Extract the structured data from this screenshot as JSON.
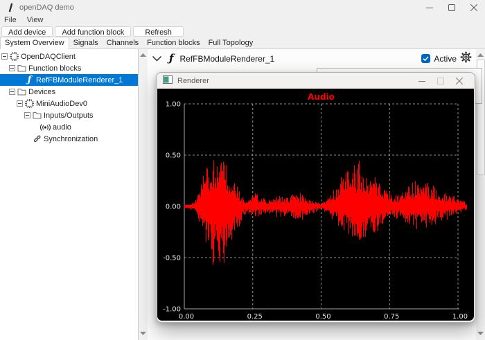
{
  "window": {
    "title": "openDAQ demo"
  },
  "menu": {
    "items": [
      "File",
      "View"
    ]
  },
  "toolbar": {
    "buttons": [
      "Add device",
      "Add function block",
      "Refresh"
    ]
  },
  "tabs": {
    "items": [
      "System Overview",
      "Signals",
      "Channels",
      "Function blocks",
      "Full Topology"
    ],
    "active": "System Overview"
  },
  "tree": {
    "items": [
      {
        "label": "OpenDAQClient",
        "icon": "chip",
        "level": 0,
        "expander": true,
        "selected": false
      },
      {
        "label": "Function blocks",
        "icon": "folder",
        "level": 1,
        "expander": true,
        "selected": false
      },
      {
        "label": "RefFBModuleRenderer_1",
        "icon": "fn",
        "level": 2,
        "expander": false,
        "selected": true
      },
      {
        "label": "Devices",
        "icon": "folder",
        "level": 1,
        "expander": true,
        "selected": false
      },
      {
        "label": "MiniAudioDev0",
        "icon": "chip",
        "level": 2,
        "expander": true,
        "selected": false
      },
      {
        "label": "Inputs/Outputs",
        "icon": "folder",
        "level": 3,
        "expander": true,
        "selected": false
      },
      {
        "label": "audio",
        "icon": "audio",
        "level": 4,
        "expander": false,
        "selected": false
      },
      {
        "label": "Synchronization",
        "icon": "link",
        "level": 3,
        "expander": false,
        "selected": false
      }
    ]
  },
  "detail": {
    "title": "RefFBModuleRenderer_1",
    "active_label": "Active",
    "active_checked": true
  },
  "renderer_window": {
    "title": "Renderer"
  },
  "colors": {
    "selection": "#0078d7",
    "checkbox_accent": "#0067c0"
  },
  "chart_data": {
    "type": "line",
    "title": "Audio",
    "title_color": "#ff0000",
    "series_color": "#ff0000",
    "background": "#000000",
    "grid": "dashed",
    "xlim": [
      0,
      1
    ],
    "ylim": [
      -1,
      1
    ],
    "x_ticks": [
      0.0,
      0.25,
      0.5,
      0.75,
      1.0
    ],
    "x_tick_labels": [
      "0.00",
      "0.25",
      "0.50",
      "0.75",
      "1.00"
    ],
    "y_ticks": [
      1.0,
      0.5,
      0.0,
      -0.5,
      -1.0
    ],
    "y_tick_labels": [
      "1.00",
      "0.50",
      "0.00",
      "-0.50",
      "-1.00"
    ],
    "envelope": [
      [
        0.0,
        0.02,
        0.02
      ],
      [
        0.02,
        0.03,
        0.03
      ],
      [
        0.04,
        0.06,
        0.06
      ],
      [
        0.06,
        0.22,
        0.2
      ],
      [
        0.08,
        0.45,
        0.42
      ],
      [
        0.1,
        0.5,
        0.52
      ],
      [
        0.12,
        0.55,
        0.58
      ],
      [
        0.14,
        0.5,
        0.62
      ],
      [
        0.16,
        0.42,
        0.45
      ],
      [
        0.18,
        0.32,
        0.35
      ],
      [
        0.2,
        0.18,
        0.2
      ],
      [
        0.22,
        0.08,
        0.09
      ],
      [
        0.24,
        0.09,
        0.08
      ],
      [
        0.26,
        0.13,
        0.11
      ],
      [
        0.28,
        0.1,
        0.09
      ],
      [
        0.3,
        0.07,
        0.07
      ],
      [
        0.32,
        0.08,
        0.08
      ],
      [
        0.34,
        0.12,
        0.1
      ],
      [
        0.36,
        0.11,
        0.1
      ],
      [
        0.38,
        0.08,
        0.09
      ],
      [
        0.4,
        0.12,
        0.14
      ],
      [
        0.42,
        0.13,
        0.15
      ],
      [
        0.44,
        0.1,
        0.11
      ],
      [
        0.46,
        0.07,
        0.07
      ],
      [
        0.48,
        0.05,
        0.05
      ],
      [
        0.5,
        0.03,
        0.03
      ],
      [
        0.52,
        0.08,
        0.07
      ],
      [
        0.54,
        0.14,
        0.12
      ],
      [
        0.56,
        0.22,
        0.18
      ],
      [
        0.58,
        0.3,
        0.24
      ],
      [
        0.6,
        0.38,
        0.3
      ],
      [
        0.62,
        0.42,
        0.33
      ],
      [
        0.64,
        0.44,
        0.35
      ],
      [
        0.66,
        0.38,
        0.32
      ],
      [
        0.68,
        0.34,
        0.3
      ],
      [
        0.7,
        0.3,
        0.28
      ],
      [
        0.72,
        0.22,
        0.2
      ],
      [
        0.74,
        0.14,
        0.13
      ],
      [
        0.76,
        0.13,
        0.12
      ],
      [
        0.78,
        0.12,
        0.12
      ],
      [
        0.8,
        0.16,
        0.14
      ],
      [
        0.82,
        0.2,
        0.17
      ],
      [
        0.84,
        0.24,
        0.2
      ],
      [
        0.86,
        0.26,
        0.21
      ],
      [
        0.88,
        0.24,
        0.2
      ],
      [
        0.9,
        0.21,
        0.18
      ],
      [
        0.92,
        0.18,
        0.16
      ],
      [
        0.94,
        0.16,
        0.14
      ],
      [
        0.96,
        0.14,
        0.12
      ],
      [
        0.98,
        0.1,
        0.09
      ],
      [
        1.0,
        0.08,
        0.07
      ],
      [
        1.02,
        0.06,
        0.05
      ],
      [
        1.03,
        0.04,
        0.04
      ]
    ]
  }
}
